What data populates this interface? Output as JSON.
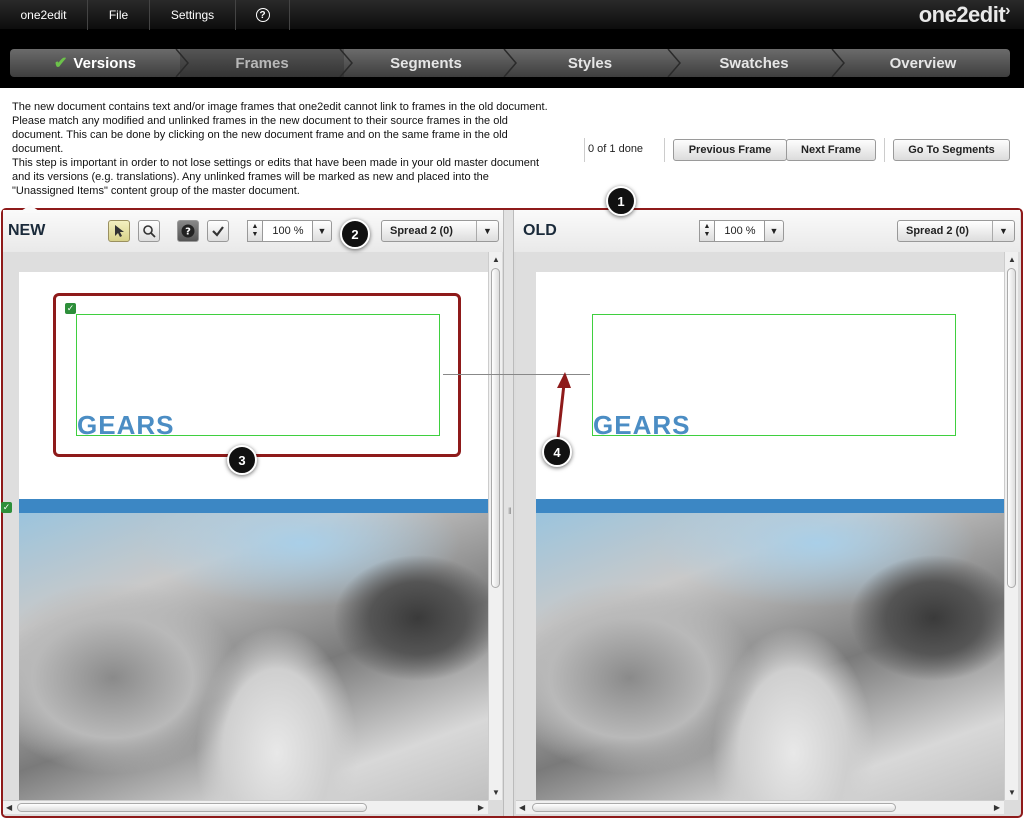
{
  "menu": {
    "app": "one2edit",
    "file": "File",
    "settings": "Settings",
    "help": "?"
  },
  "logo": "one2edit",
  "wizard": {
    "steps": [
      {
        "label": "Versions",
        "state": "done"
      },
      {
        "label": "Frames",
        "state": "current"
      },
      {
        "label": "Segments",
        "state": ""
      },
      {
        "label": "Styles",
        "state": ""
      },
      {
        "label": "Swatches",
        "state": ""
      },
      {
        "label": "Overview",
        "state": ""
      }
    ]
  },
  "instructions": [
    "The new document contains text and/or image frames that one2edit cannot link to frames in the old document.",
    "Please match any modified and unlinked frames in the new document to their source frames in the old",
    "document. This can be done by clicking on the new document frame and on the same frame in the old",
    "document.",
    "This step is important in order to not lose settings or edits that have been made in your old master document",
    "and its versions (e.g. translations). Any unlinked frames will be marked as new and placed into the",
    "\"Unassigned Items\" content group of the master document."
  ],
  "progress": "0 of 1 done",
  "buttons": {
    "previous": "Previous Frame",
    "next": "Next Frame",
    "segments": "Go To Segments"
  },
  "callouts": [
    "1",
    "2",
    "3",
    "4"
  ],
  "new_panel": {
    "title": "NEW",
    "zoom": "100 %",
    "spread": "Spread 2 (0)",
    "heading": "GEARS"
  },
  "old_panel": {
    "title": "OLD",
    "zoom": "100 %",
    "spread": "Spread 2 (0)",
    "heading": "GEARS"
  },
  "colors": {
    "accent_red": "#8e1a1a",
    "frame_green": "#3fcf3f",
    "brand_blue": "#4b8dc4",
    "check_green": "#6cc24a"
  }
}
